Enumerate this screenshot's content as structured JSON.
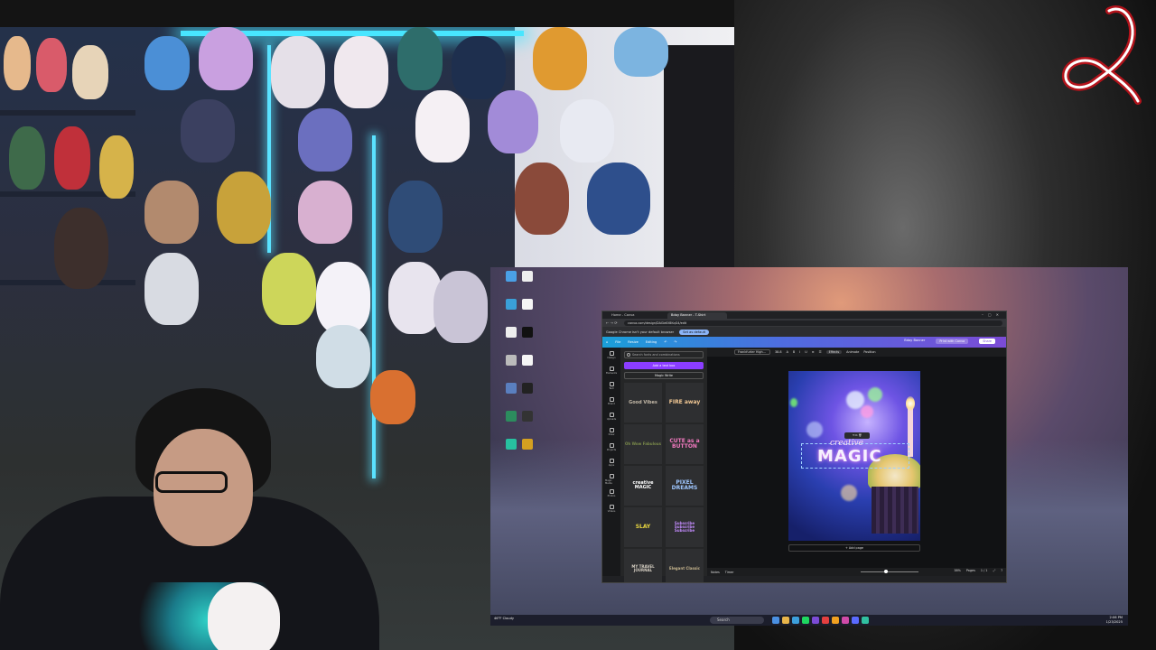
{
  "browser": {
    "tabs": [
      {
        "label": "Home - Canva"
      },
      {
        "label": "Bday Banner - T-Shirt"
      }
    ],
    "url": "canva.com/design/DAGbKV8KqG4/edit",
    "infobar": {
      "message": "Google Chrome isn't your default browser",
      "button": "Set as default"
    }
  },
  "canva": {
    "menu": {
      "file": "File",
      "resize": "Resize",
      "editing": "Editing"
    },
    "design_title": "Bday Banner",
    "print_button": "Print with Canva",
    "share_button": "Share",
    "rail": [
      {
        "label": "Design",
        "icon": "design-icon"
      },
      {
        "label": "Elements",
        "icon": "elements-icon"
      },
      {
        "label": "Text",
        "icon": "text-icon"
      },
      {
        "label": "Brand",
        "icon": "brand-icon"
      },
      {
        "label": "Uploads",
        "icon": "uploads-icon"
      },
      {
        "label": "Draw",
        "icon": "draw-icon"
      },
      {
        "label": "Projects",
        "icon": "projects-icon"
      },
      {
        "label": "Apps",
        "icon": "apps-icon"
      },
      {
        "label": "Magic Media",
        "icon": "magic-media-icon"
      },
      {
        "label": "Photos",
        "icon": "photos-icon"
      },
      {
        "label": "Videos",
        "icon": "videos-icon"
      }
    ],
    "panel": {
      "search_placeholder": "Search fonts and combinations",
      "add_textbox": "Add a text box",
      "magic_write": "Magic Write",
      "tiles": [
        {
          "text": "Good Vibes",
          "color": "#c4b9a8",
          "size": "5px"
        },
        {
          "text": "FIRE away",
          "color": "#f2c894",
          "size": "6px"
        },
        {
          "text": "Oh Wow Fabulous",
          "color": "#7a8a4a",
          "size": "4px"
        },
        {
          "text": "CUTE as a BUTTON",
          "color": "#f37ac0",
          "size": "6px"
        },
        {
          "text": "creative MAGIC",
          "color": "#ffffff",
          "size": "5px"
        },
        {
          "text": "PIXEL DREAMS",
          "color": "#9ec6ff",
          "size": "6px"
        },
        {
          "text": "SLAY",
          "color": "#e8d640",
          "size": "6px"
        },
        {
          "text": "Subscribe Subscribe Subscribe",
          "color": "#c48cff",
          "size": "4px"
        },
        {
          "text": "MY TRAVEL JOURNAL",
          "color": "#d7d0c4",
          "size": "4px"
        },
        {
          "text": "Elegant Classic",
          "color": "#c9b890",
          "size": "4px"
        }
      ]
    },
    "toolbar": {
      "font": "Frankfurter High...",
      "size": "38.8",
      "effects": "Effects",
      "animate": "Animate",
      "position": "Position"
    },
    "artboard": {
      "script_text": "creative",
      "headline": "MAGIC"
    },
    "add_page": "+ Add page",
    "footer": {
      "notes": "Notes",
      "timer": "Timer",
      "zoom": "38%",
      "pages": "Pages",
      "page_count": "1 / 1"
    }
  },
  "taskbar": {
    "search_placeholder": "Search",
    "weather": "46°F Cloudy",
    "time": "2:06 PM",
    "date": "1/23/2025"
  },
  "colors": {
    "canva_purple": "#8b3dff",
    "canva_gradient_start": "#1a9fd8",
    "canva_gradient_end": "#7b4bd6",
    "neon": "#48e6ff",
    "logo_red": "#b3131b"
  }
}
